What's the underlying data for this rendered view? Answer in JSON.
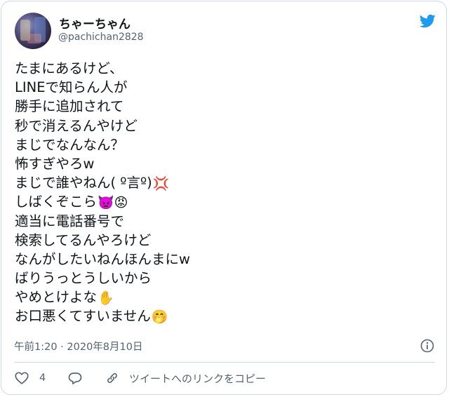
{
  "user": {
    "display_name": "ちゃーちゃん",
    "handle": "@pachichan2828"
  },
  "tweet": {
    "lines": [
      {
        "text": "たまにあるけど、",
        "emoji": ""
      },
      {
        "text": "LINEで知らん人が",
        "emoji": ""
      },
      {
        "text": "勝手に追加されて",
        "emoji": ""
      },
      {
        "text": "秒で消えるんやけど",
        "emoji": ""
      },
      {
        "text": "まじでなんなん？",
        "emoji": ""
      },
      {
        "text": "怖すぎやろw",
        "emoji": ""
      },
      {
        "text": "まじで誰やねん( º言º)",
        "emoji": "💢"
      },
      {
        "text": "しばくぞこら",
        "emoji": "👿😡"
      },
      {
        "text": "適当に電話番号で",
        "emoji": ""
      },
      {
        "text": "検索してるんやろけど",
        "emoji": ""
      },
      {
        "text": "なんがしたいねんほんまにw",
        "emoji": ""
      },
      {
        "text": "ばりうっとうしいから",
        "emoji": ""
      },
      {
        "text": "やめとけよな",
        "emoji": "✋"
      },
      {
        "text": "お口悪くてすいません",
        "emoji": "🤭"
      }
    ]
  },
  "meta": {
    "timestamp": "午前1:20 · 2020年8月10日"
  },
  "actions": {
    "like_count": "4",
    "copy_link_label": "ツイートへのリンクをコピー"
  },
  "colors": {
    "twitter_blue": "#1d9bf0",
    "text_primary": "#0f1419",
    "text_secondary": "#536471",
    "border": "#cfd9de"
  },
  "icons": [
    "twitter-bird-icon",
    "info-icon",
    "heart-icon",
    "reply-icon",
    "link-icon"
  ]
}
